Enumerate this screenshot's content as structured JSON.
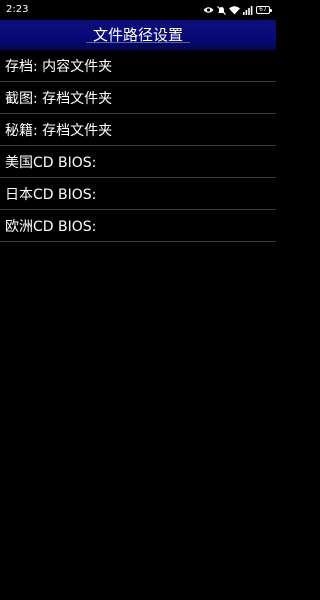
{
  "status_bar": {
    "time": "2:23",
    "battery": "67",
    "icons": [
      "eye-icon",
      "mute-icon",
      "wifi-icon",
      "signal-icon",
      "battery-icon"
    ]
  },
  "header": {
    "title": "文件路径设置"
  },
  "settings": {
    "items": [
      {
        "label": "存档: 内容文件夹"
      },
      {
        "label": "截图: 存档文件夹"
      },
      {
        "label": "秘籍: 存档文件夹"
      },
      {
        "label": "美国CD BIOS:"
      },
      {
        "label": "日本CD BIOS:"
      },
      {
        "label": "欧洲CD BIOS:"
      }
    ]
  },
  "colors": {
    "background": "#000000",
    "title_bar": "#08097a",
    "divider": "#3b3b3b",
    "text": "#ffffff"
  }
}
